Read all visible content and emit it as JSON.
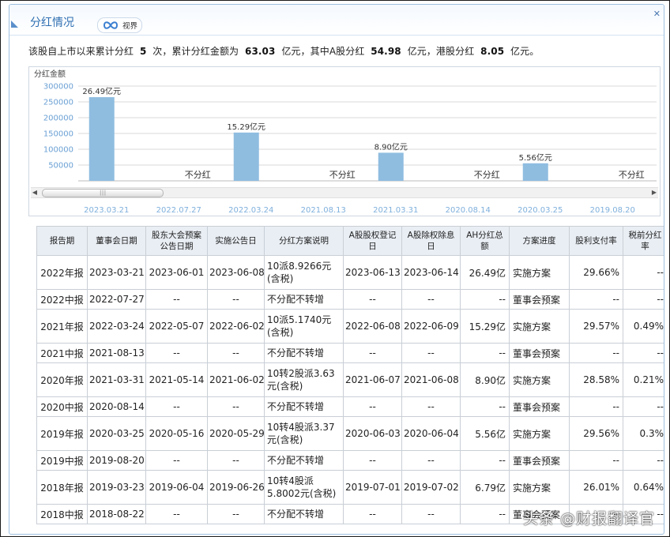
{
  "header": {
    "title": "分红情况",
    "vision_label": "视界"
  },
  "summary": {
    "prefix": "该股自上市以来累计分红",
    "count": "5",
    "count_unit": "次，累计分红金额为",
    "total": "63.03",
    "total_unit": "亿元，其中A股分红",
    "a_share": "54.98",
    "a_unit": "亿元，港股分红",
    "hk_share": "8.05",
    "hk_unit": "亿元。"
  },
  "chart_data": {
    "type": "bar",
    "ylabel": "分红金额",
    "yticks": [
      50000,
      100000,
      150000,
      200000,
      250000,
      300000
    ],
    "ylim": [
      0,
      330000
    ],
    "grid": true,
    "categories": [
      "2023.03.21",
      "2022.07.27",
      "2022.03.24",
      "2021.08.13",
      "2021.03.31",
      "2020.08.14",
      "2020.03.25",
      "2019.08.20"
    ],
    "values": [
      264900,
      0,
      152900,
      0,
      89000,
      0,
      55600,
      0
    ],
    "labels": [
      "26.49亿元",
      "不分红",
      "15.29亿元",
      "不分红",
      "8.90亿元",
      "不分红",
      "5.56亿元",
      "不分红"
    ],
    "bar_color": "#8fbde0"
  },
  "table": {
    "headers": [
      "报告期",
      "董事会日期",
      "股东大会预案公告日期",
      "实施公告日",
      "分红方案说明",
      "A股股权登记日",
      "A股除权除息日",
      "AH分红总额",
      "方案进度",
      "股利支付率",
      "税前分红率"
    ],
    "rows": [
      [
        "2022年报",
        "2023-03-21",
        "2023-06-01",
        "2023-06-08",
        "10派8.9266元(含税)",
        "2023-06-13",
        "2023-06-14",
        "26.49亿",
        "实施方案",
        "29.66%",
        "--"
      ],
      [
        "2022中报",
        "2022-07-27",
        "--",
        "--",
        "不分配不转增",
        "--",
        "--",
        "--",
        "董事会预案",
        "--",
        "--"
      ],
      [
        "2021年报",
        "2022-03-24",
        "2022-05-07",
        "2022-06-02",
        "10派5.1740元(含税)",
        "2022-06-08",
        "2022-06-09",
        "15.29亿",
        "实施方案",
        "29.57%",
        "0.49%"
      ],
      [
        "2021中报",
        "2021-08-13",
        "--",
        "--",
        "不分配不转增",
        "--",
        "--",
        "--",
        "董事会预案",
        "--",
        "--"
      ],
      [
        "2020年报",
        "2021-03-31",
        "2021-05-14",
        "2021-06-02",
        "10转2股派3.63元(含税)",
        "2021-06-07",
        "2021-06-08",
        "8.90亿",
        "实施方案",
        "28.58%",
        "0.21%"
      ],
      [
        "2020中报",
        "2020-08-14",
        "--",
        "--",
        "不分配不转增",
        "--",
        "--",
        "--",
        "董事会预案",
        "--",
        "--"
      ],
      [
        "2019年报",
        "2020-03-25",
        "2020-05-16",
        "2020-05-29",
        "10转4股派3.37元(含税)",
        "2020-06-03",
        "2020-06-04",
        "5.56亿",
        "实施方案",
        "29.56%",
        "0.3%"
      ],
      [
        "2019中报",
        "2019-08-20",
        "--",
        "--",
        "不分配不转增",
        "--",
        "--",
        "--",
        "董事会预案",
        "--",
        "--"
      ],
      [
        "2018年报",
        "2019-03-23",
        "2019-06-04",
        "2019-06-26",
        "10转4股派5.8002元(含税)",
        "2019-07-01",
        "2019-07-02",
        "6.79亿",
        "实施方案",
        "26.01%",
        "0.64%"
      ],
      [
        "2018中报",
        "2018-08-22",
        "--",
        "--",
        "不分配不转增",
        "--",
        "--",
        "--",
        "董事会预案",
        "--",
        "--"
      ]
    ]
  },
  "watermark": "头条 @财报翻译官"
}
